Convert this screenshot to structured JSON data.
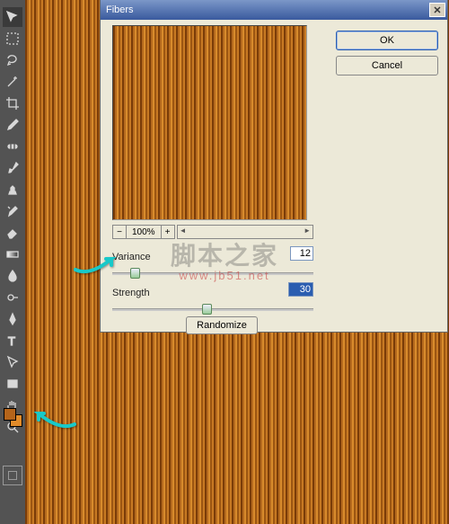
{
  "dialog": {
    "title": "Fibers",
    "ok_label": "OK",
    "cancel_label": "Cancel",
    "zoom_pct": "100%",
    "variance_label": "Variance",
    "variance_value": "12",
    "strength_label": "Strength",
    "strength_value": "30",
    "randomize_label": "Randomize"
  },
  "swatch": {
    "foreground": "#b4641a",
    "background": "#e08b2a"
  },
  "watermark": {
    "line1": "脚本之家",
    "line2": "www.jb51.net"
  },
  "tools": [
    "move",
    "marquee",
    "lasso",
    "magic-wand",
    "crop",
    "eyedropper",
    "healing-brush",
    "brush",
    "clone-stamp",
    "history-brush",
    "eraser",
    "gradient",
    "blur",
    "dodge",
    "pen",
    "type",
    "path-select",
    "rectangle",
    "hand",
    "zoom"
  ]
}
